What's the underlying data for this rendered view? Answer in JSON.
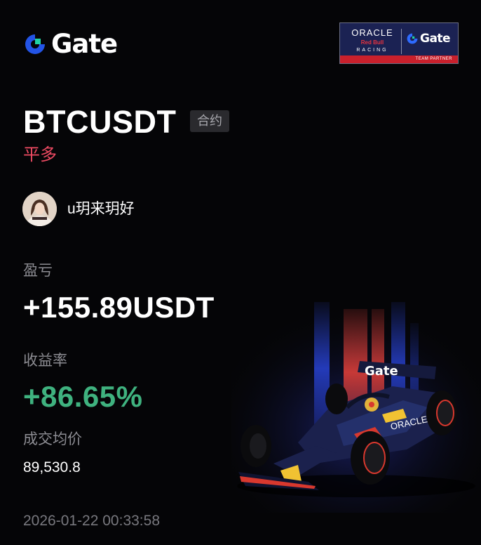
{
  "brand": {
    "name": "Gate",
    "accent": "#2354e6"
  },
  "partner_badge": {
    "oracle": "ORACLE",
    "red_bull": "Red Bull",
    "racing": "RACING",
    "gate": "Gate",
    "footer": "TEAM PARTNER"
  },
  "position": {
    "pair": "BTCUSDT",
    "type_tag": "合约",
    "side": "平多"
  },
  "user": {
    "name": "u玥来玥好"
  },
  "stats": {
    "pnl_label": "盈亏",
    "pnl_value": "+155.89USDT",
    "roi_label": "收益率",
    "roi_value": "+86.65%",
    "price_label": "成交均价",
    "price_value": "89,530.8"
  },
  "timestamp": "2026-01-22 00:33:58",
  "colors": {
    "long_red": "#ee4b63",
    "profit_green": "#3fb27f"
  },
  "car_livery": {
    "text": "Gate"
  }
}
